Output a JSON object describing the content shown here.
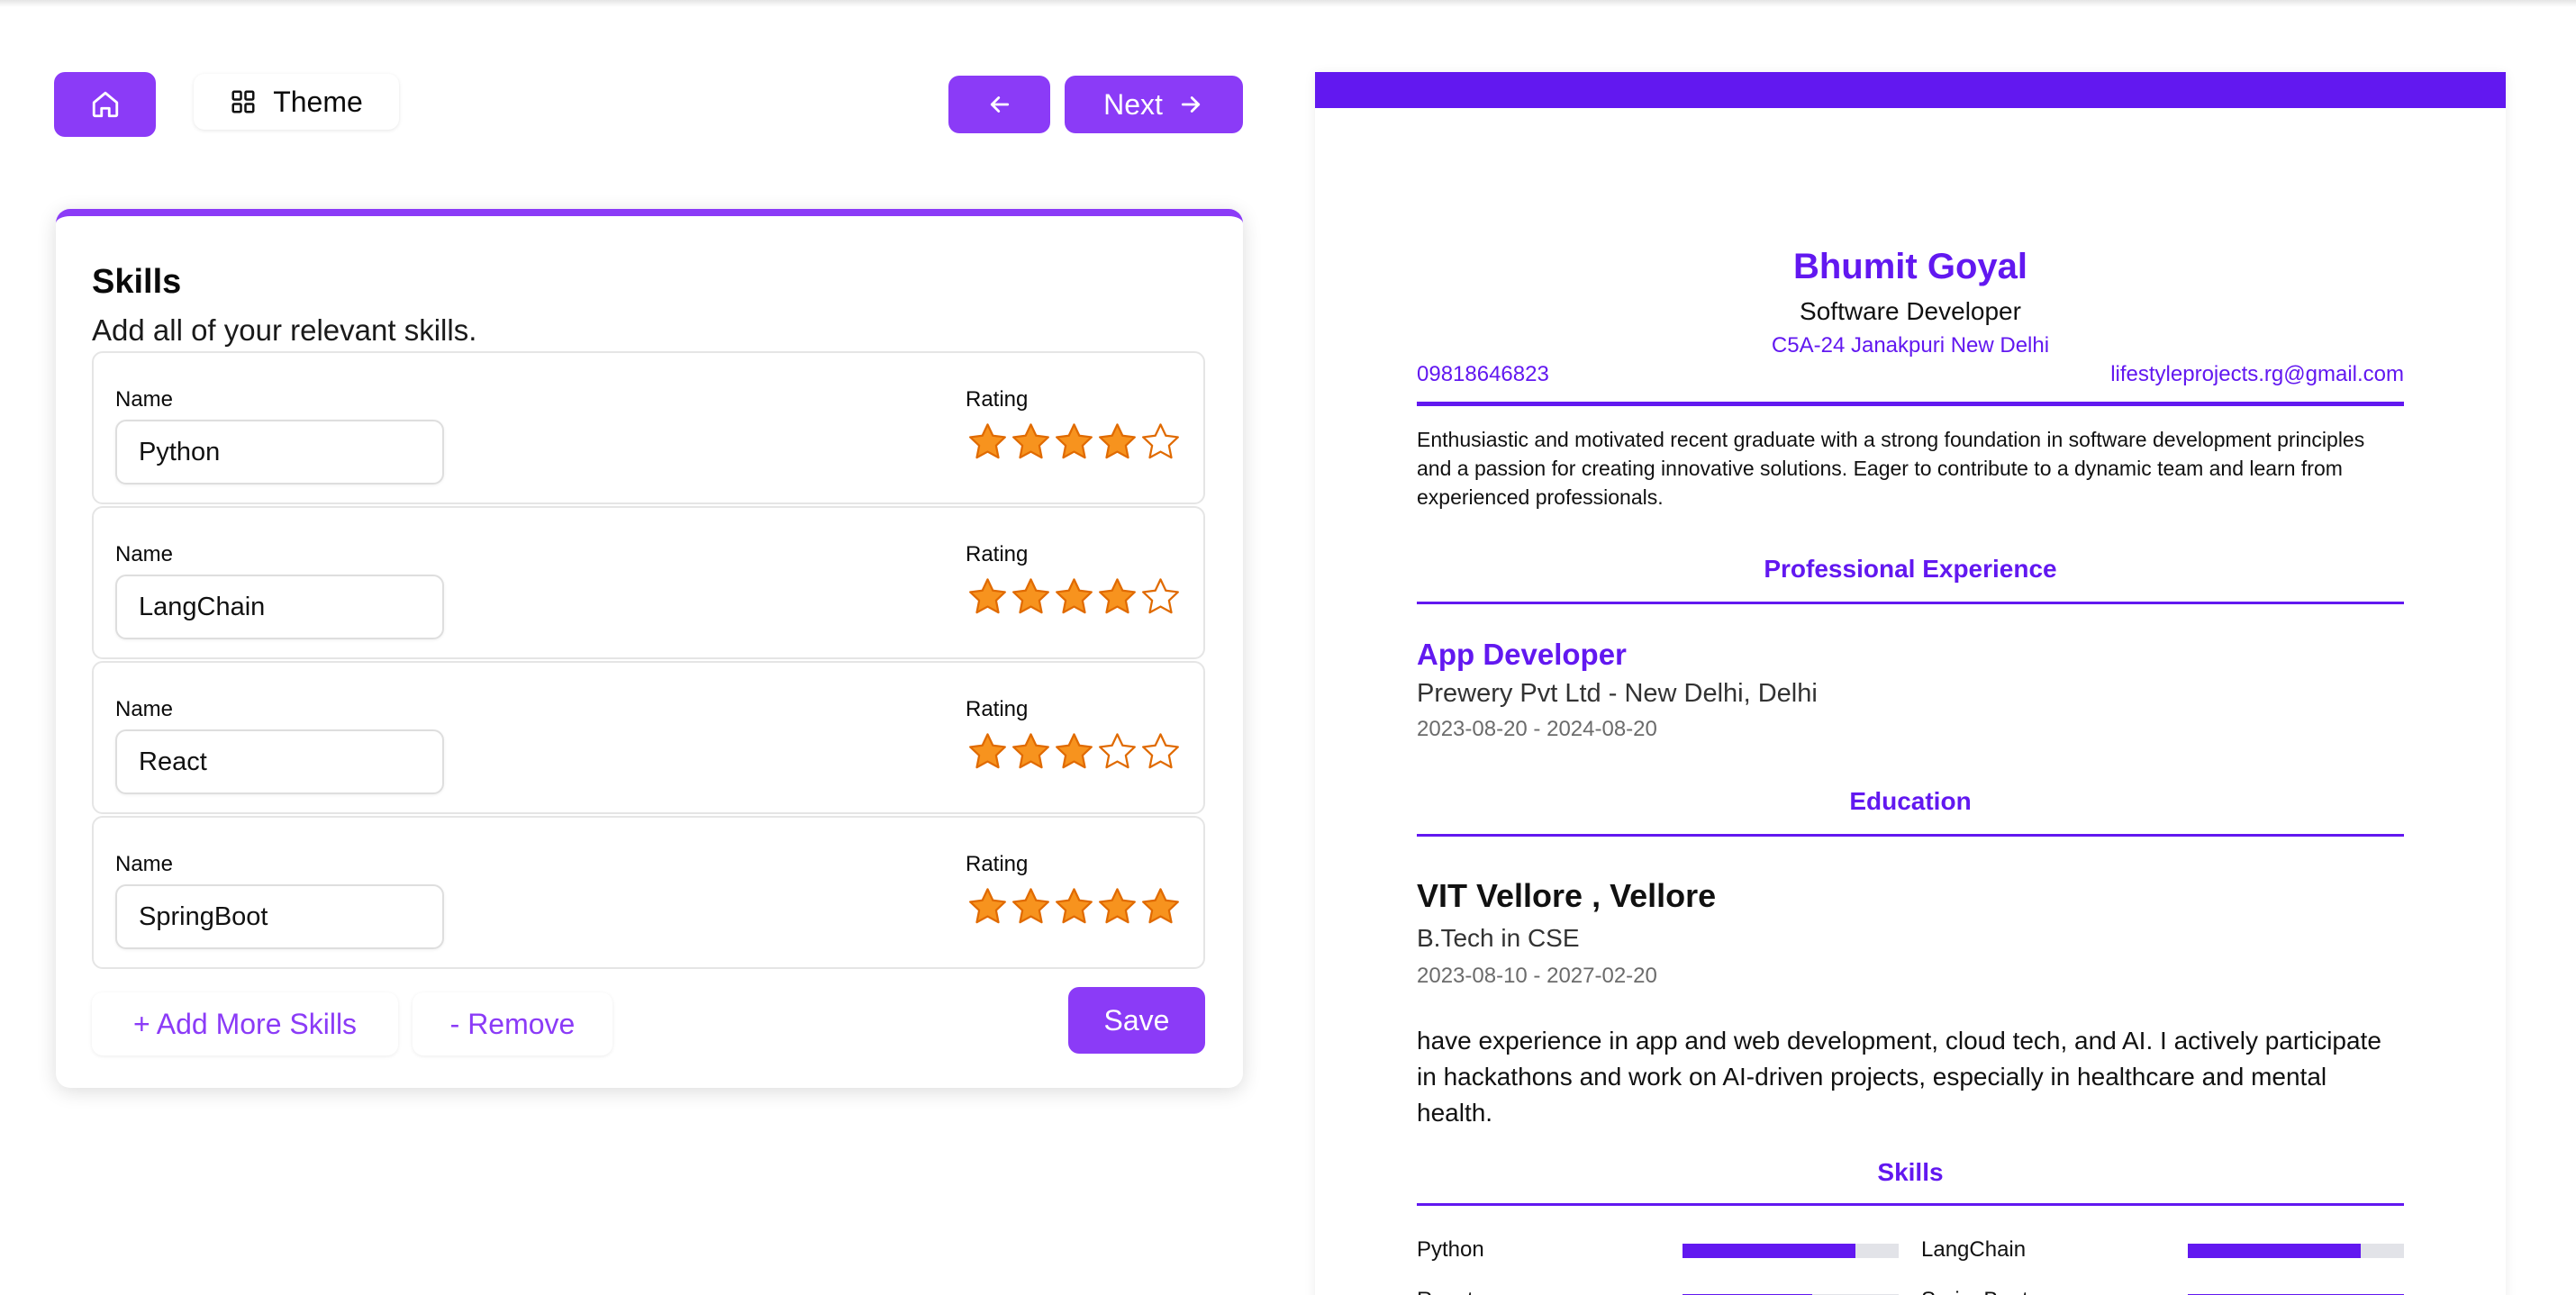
{
  "toolbar": {
    "theme_label": "Theme",
    "next_label": "Next"
  },
  "colors": {
    "accent": "#8b3bf7",
    "resume_accent": "#6218f0",
    "star_fill": "#f7931e",
    "star_outline": "#e06a00"
  },
  "skills_form": {
    "title": "Skills",
    "subtitle": "Add all of your relevant skills.",
    "name_label": "Name",
    "rating_label": "Rating",
    "items": [
      {
        "name": "Python",
        "rating": 4
      },
      {
        "name": "LangChain",
        "rating": 4
      },
      {
        "name": "React",
        "rating": 3
      },
      {
        "name": "SpringBoot",
        "rating": 5
      }
    ],
    "max_rating": 5,
    "add_label": "+ Add More Skills",
    "remove_label": "- Remove",
    "save_label": "Save"
  },
  "resume": {
    "name": "Bhumit Goyal",
    "role": "Software Developer",
    "address": "C5A-24 Janakpuri New Delhi",
    "phone": "09818646823",
    "email": "lifestyleprojects.rg@gmail.com",
    "summary": "Enthusiastic and motivated recent graduate with a strong foundation in software development principles and a passion for creating innovative solutions. Eager to contribute to a dynamic team and learn from experienced professionals.",
    "experience_heading": "Professional Experience",
    "experience": {
      "title": "App Developer",
      "company": "Prewery Pvt Ltd - New Delhi, Delhi",
      "dates": "2023-08-20 - 2024-08-20"
    },
    "education_heading": "Education",
    "education": {
      "school": "VIT Vellore , Vellore",
      "degree": "B.Tech in CSE",
      "dates": "2023-08-10 - 2027-02-20",
      "description": "have experience in app and web development, cloud tech, and AI. I actively participate in hackathons and work on AI-driven projects, especially in healthcare and mental health."
    },
    "skills_heading": "Skills",
    "skills": [
      {
        "name": "Python",
        "level": 0.8
      },
      {
        "name": "LangChain",
        "level": 0.8
      },
      {
        "name": "React",
        "level": 0.6
      },
      {
        "name": "SpringBoot",
        "level": 1.0
      }
    ]
  }
}
